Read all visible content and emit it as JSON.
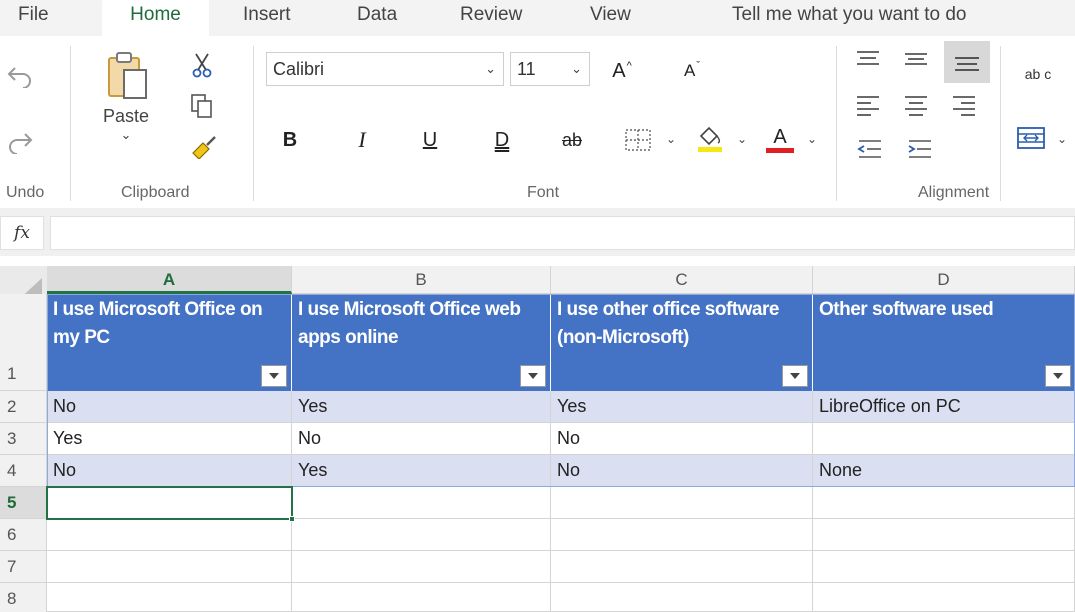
{
  "menu": {
    "tabs": [
      {
        "label": "File"
      },
      {
        "label": "Home",
        "active": true
      },
      {
        "label": "Insert"
      },
      {
        "label": "Data"
      },
      {
        "label": "Review"
      },
      {
        "label": "View"
      },
      {
        "label": "Tell me what you want to do"
      }
    ]
  },
  "ribbon": {
    "undo_group_label": "Undo",
    "clipboard_group_label": "Clipboard",
    "paste_label": "Paste",
    "font_group_label": "Font",
    "alignment_group_label": "Alignment",
    "font_name": "Calibri",
    "font_size": "11",
    "bold": "B",
    "italic": "I",
    "underline": "U",
    "double_underline": "D",
    "strikethrough": "ab",
    "font_color_letter": "A",
    "grow_font": "A",
    "shrink_font": "A",
    "fill_color": "#f5e616",
    "font_color": "#e02020",
    "wrap_text": "ab c",
    "caret": "⌄"
  },
  "formula_bar": {
    "fx_label": "fx",
    "value": ""
  },
  "sheet": {
    "columns": [
      "A",
      "B",
      "C",
      "D"
    ],
    "active_column": "A",
    "row_numbers": [
      "1",
      "2",
      "3",
      "4",
      "5",
      "6",
      "7",
      "8"
    ],
    "active_row": "5",
    "header_row": [
      "I use Microsoft Office on my PC",
      "I use Microsoft Office web apps online",
      "I use other office software (non-Microsoft)",
      "Other software used"
    ],
    "rows": [
      [
        "No",
        "Yes",
        "Yes",
        "LibreOffice on PC"
      ],
      [
        "Yes",
        "No",
        "No",
        ""
      ],
      [
        "No",
        "Yes",
        "No",
        "None"
      ]
    ],
    "table_header_color": "#4472c4",
    "band_color": "#dae0f2",
    "accent_color": "#217346"
  }
}
